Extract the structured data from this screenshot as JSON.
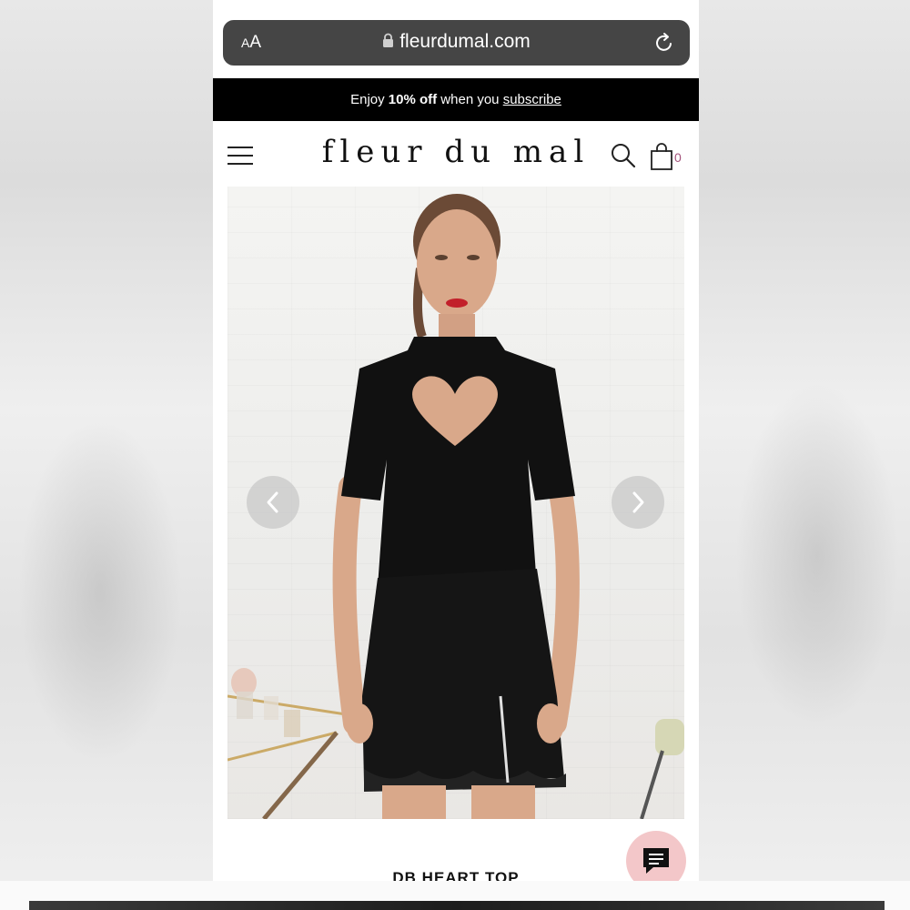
{
  "browser": {
    "text_size_label_small": "A",
    "text_size_label_large": "A",
    "url": "fleurdumal.com"
  },
  "promo": {
    "prefix": "Enjoy ",
    "highlight": "10% off",
    "middle": " when you ",
    "link": "subscribe"
  },
  "header": {
    "logo": "fleur du mal",
    "cart_count": "0"
  },
  "product": {
    "title": "DB HEART TOP"
  },
  "colors": {
    "promo_bg": "#000000",
    "url_bar_bg": "#454545",
    "cart_count": "#a3527a",
    "chat_button": "#f3c7c9"
  },
  "icons": [
    "menu-icon",
    "lock-icon",
    "reload-icon",
    "search-icon",
    "bag-icon",
    "chevron-left-icon",
    "chevron-right-icon",
    "chat-icon"
  ]
}
